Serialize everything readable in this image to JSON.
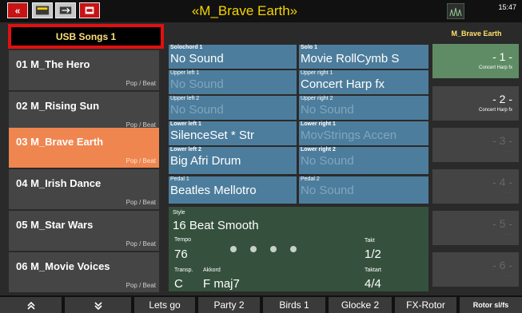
{
  "header": {
    "title": "«M_Brave Earth»",
    "time": "15:47"
  },
  "song_list": {
    "title": "USB Songs 1",
    "items": [
      {
        "name": "01 M_The Hero",
        "genre": "Pop / Beat"
      },
      {
        "name": "02 M_Rising Sun",
        "genre": "Pop / Beat"
      },
      {
        "name": "03 M_Brave Earth",
        "genre": "Pop / Beat"
      },
      {
        "name": "04 M_Irish Dance",
        "genre": "Pop / Beat"
      },
      {
        "name": "05 M_Star Wars",
        "genre": "Pop / Beat"
      },
      {
        "name": "06 M_Movie Voices",
        "genre": "Pop / Beat"
      }
    ]
  },
  "voices": {
    "solochord1": {
      "label": "Solochord 1",
      "value": "No Sound"
    },
    "solo1": {
      "label": "Solo 1",
      "value": "Movie RollCymb S"
    },
    "upper_left1": {
      "label": "Upper left 1",
      "value": "No Sound"
    },
    "upper_right1": {
      "label": "Upper right 1",
      "value": "Concert Harp  fx"
    },
    "upper_left2": {
      "label": "Upper left 2",
      "value": "No Sound"
    },
    "upper_right2": {
      "label": "Upper right 2",
      "value": "No Sound"
    },
    "lower_left1": {
      "label": "Lower left 1",
      "value": "SilenceSet * Str"
    },
    "lower_right1": {
      "label": "Lower right 1",
      "value": "MovStrings Accen"
    },
    "lower_left2": {
      "label": "Lower left 2",
      "value": "Big Afri Drum"
    },
    "lower_right2": {
      "label": "Lower right 2",
      "value": "No Sound"
    },
    "pedal1": {
      "label": "Pedal 1",
      "value": "Beatles Mellotro"
    },
    "pedal2": {
      "label": "Pedal 2",
      "value": "No Sound"
    }
  },
  "style_panel": {
    "style_label": "Style",
    "style_value": "16 Beat Smooth",
    "tempo_label": "Tempo",
    "tempo_value": "76",
    "takt_label": "Takt",
    "takt_value": "1/2",
    "transp_label": "Transp.",
    "transp_value": "C",
    "akkord_label": "Akkord",
    "akkord_value": "F  maj7",
    "taktart_label": "Taktart",
    "taktart_value": "4/4"
  },
  "registrations": {
    "title": "M_Brave Earth",
    "items": [
      {
        "num": "- 1 -",
        "label": "Concert Harp  fx"
      },
      {
        "num": "- 2 -",
        "label": "Concert Harp  fx"
      },
      {
        "num": "- 3 -",
        "label": "- - -"
      },
      {
        "num": "- 4 -",
        "label": "- - -"
      },
      {
        "num": "- 5 -",
        "label": "- - -"
      },
      {
        "num": "- 6 -",
        "label": "- - -"
      }
    ]
  },
  "bottom": {
    "scroll_up": "≈",
    "scroll_down": "≈",
    "buttons": [
      "Lets go",
      "Party 2",
      "Birds 1",
      "Glocke 2",
      "FX-Rotor",
      "Rotor sl/fs"
    ]
  },
  "colors": {
    "accent_title": "#f5d300",
    "selected_song": "#ef8650",
    "voice_cell": "#4d7d9c",
    "active_registration": "#5f8c64",
    "highlight_border": "#e01010"
  },
  "icons": [
    "back-arrows-icon",
    "folder-icon",
    "usb-icon",
    "record-icon",
    "panel-icon"
  ]
}
